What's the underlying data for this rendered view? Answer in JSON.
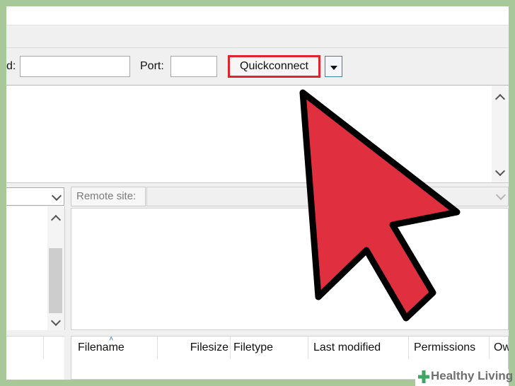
{
  "quickconnect_bar": {
    "host_label_fragment": "d:",
    "host_value": "",
    "port_label": "Port:",
    "port_value": "",
    "quickconnect_label": "Quickconnect",
    "highlight_color": "#e0242d"
  },
  "local_panel": {
    "path_value": ""
  },
  "remote_panel": {
    "site_label": "Remote site:",
    "path_value": "",
    "columns": [
      "Filename",
      "Filesize",
      "Filetype",
      "Last modified",
      "Permissions",
      "Ow"
    ],
    "sorted_column": "Filename"
  },
  "overlay": {
    "arrow_color": "#e0303f",
    "arrow_outline_color": "#000000"
  },
  "watermark": {
    "text": "Healthy Living",
    "icon": "plus-cross-icon",
    "icon_color": "#3fa564"
  }
}
